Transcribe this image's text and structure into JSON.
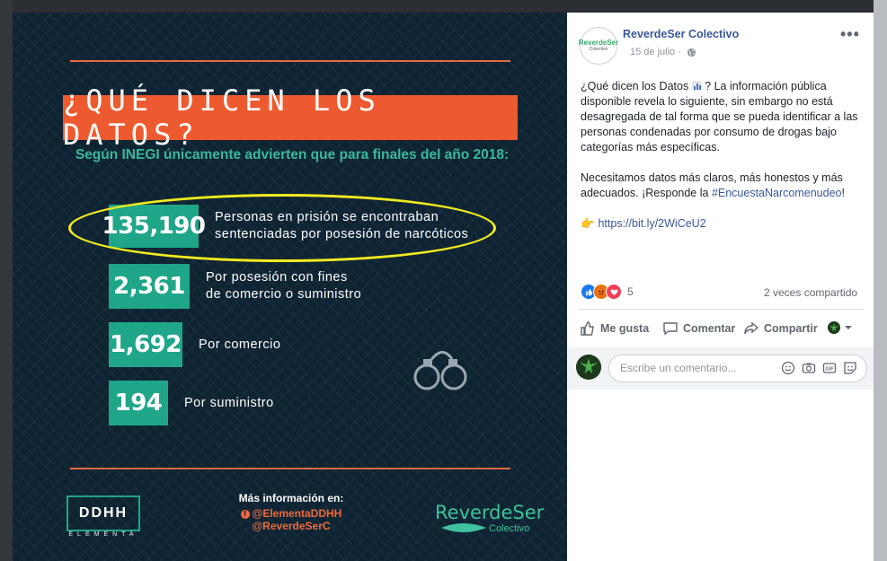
{
  "infographic": {
    "title": "¿QUÉ DICEN LOS DATOS?",
    "subtitle": "Según INEGI únicamente advierten que para finales del año 2018:",
    "stats": [
      {
        "number": "135,190",
        "line1": "Personas en prisión se encontraban",
        "line2": "sentenciadas por posesión de narcóticos"
      },
      {
        "number": "2,361",
        "line1": "Por posesión con fines",
        "line2": "de comercio o suministro"
      },
      {
        "number": "1,692",
        "line1": "Por comercio",
        "line2": ""
      },
      {
        "number": "194",
        "line1": "Por suministro",
        "line2": ""
      }
    ],
    "footer": {
      "ddhh_logo": "DDHH",
      "ddhh_sub": "ELEMENTA",
      "more_info_label": "Más información en:",
      "handles": "@ElementaDDHH @ReverdeSerC",
      "reverdeser_logo": "ReverdeSer",
      "reverdeser_sub": "Colectivo"
    },
    "colors": {
      "banner": "#ee5a2f",
      "teal": "#1fa689",
      "highlight": "#f2ea1f",
      "background": "#0f2433"
    }
  },
  "post": {
    "avatar_text": "ReverdeSer",
    "avatar_sub": "Colectivo",
    "page_name": "ReverdeSer Colectivo",
    "date": "15 de julio",
    "more_menu": "•••",
    "text": {
      "p1_before_emoji": "¿Qué dicen los Datos ",
      "p1_after_emoji": " ? La información pública disponible revela lo siguiente, sin embargo no está desagregada de tal forma que se pueda identificar a las personas condenadas por consumo de drogas bajo categorías más específicas.",
      "p2": "Necesitamos datos más claros, más honestos y más adecuados. ¡Responde la ",
      "hashtag": "#EncuestaNarcomenudeo",
      "p2_end": "!",
      "link_emoji": "👉",
      "link": "https://bit.ly/2WiCeU2"
    },
    "reaction_count": "5",
    "shares": "2 veces compartido",
    "actions": {
      "like": "Me gusta",
      "comment": "Comentar",
      "share": "Compartir"
    },
    "comment_placeholder": "Escribe un comentario..."
  }
}
